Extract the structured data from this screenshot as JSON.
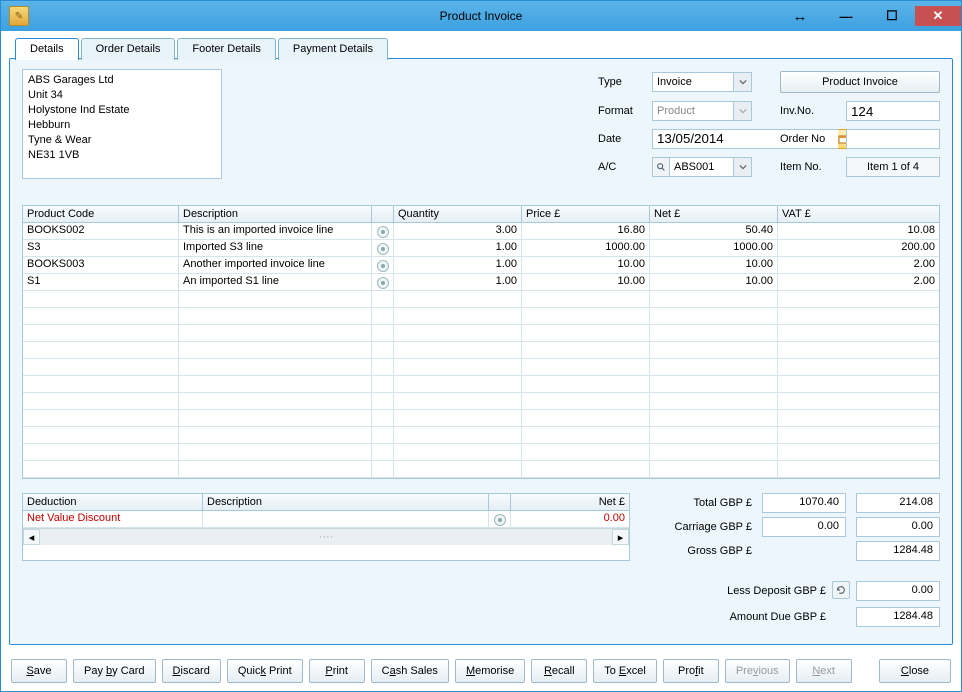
{
  "window": {
    "title": "Product Invoice"
  },
  "tabs": [
    "Details",
    "Order Details",
    "Footer Details",
    "Payment Details"
  ],
  "address": [
    "ABS Garages Ltd",
    "Unit 34",
    "Holystone Ind Estate",
    "Hebburn",
    "Tyne & Wear",
    "NE31 1VB"
  ],
  "meta": {
    "type_label": "Type",
    "type_value": "Invoice",
    "format_label": "Format",
    "format_value": "Product",
    "date_label": "Date",
    "date_value": "13/05/2014",
    "ac_label": "A/C",
    "ac_value": "ABS001",
    "btn_product_invoice": "Product Invoice",
    "invno_label": "Inv.No.",
    "invno_value": "124",
    "orderno_label": "Order No",
    "orderno_value": "",
    "itemno_label": "Item No.",
    "itemno_value": "Item 1 of 4"
  },
  "grid": {
    "headers": {
      "code": "Product Code",
      "desc": "Description",
      "qty": "Quantity",
      "price": "Price £",
      "net": "Net £",
      "vat": "VAT £"
    },
    "rows": [
      {
        "code": "BOOKS002",
        "desc": "This is an imported invoice line",
        "qty": "3.00",
        "price": "16.80",
        "net": "50.40",
        "vat": "10.08"
      },
      {
        "code": "S3",
        "desc": "Imported S3 line",
        "qty": "1.00",
        "price": "1000.00",
        "net": "1000.00",
        "vat": "200.00"
      },
      {
        "code": "BOOKS003",
        "desc": "Another imported invoice line",
        "qty": "1.00",
        "price": "10.00",
        "net": "10.00",
        "vat": "2.00"
      },
      {
        "code": "S1",
        "desc": "An imported S1 line",
        "qty": "1.00",
        "price": "10.00",
        "net": "10.00",
        "vat": "2.00"
      }
    ],
    "empty_rows": 11
  },
  "deduction": {
    "headers": {
      "ded": "Deduction",
      "desc": "Description",
      "net": "Net £"
    },
    "row": {
      "name": "Net Value Discount",
      "desc": "",
      "net": "0.00"
    }
  },
  "totals": {
    "total_label": "Total GBP £",
    "total_net": "1070.40",
    "total_vat": "214.08",
    "carriage_label": "Carriage GBP £",
    "carriage_net": "0.00",
    "carriage_vat": "0.00",
    "gross_label": "Gross GBP £",
    "gross_value": "1284.48",
    "less_deposit_label": "Less Deposit GBP £",
    "less_deposit_value": "0.00",
    "amount_due_label": "Amount Due GBP £",
    "amount_due_value": "1284.48"
  },
  "footer": {
    "save": "Save",
    "pay_by_card": "Pay by Card",
    "discard": "Discard",
    "quick_print": "Quick Print",
    "print": "Print",
    "cash_sales": "Cash Sales",
    "memorise": "Memorise",
    "recall": "Recall",
    "to_excel": "To Excel",
    "profit": "Profit",
    "previous": "Previous",
    "next": "Next",
    "close": "Close"
  }
}
